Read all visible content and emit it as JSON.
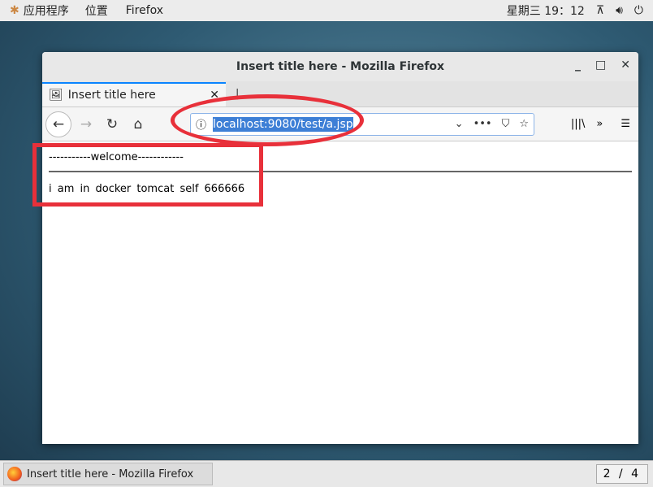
{
  "topbar": {
    "apps": "应用程序",
    "places": "位置",
    "app": "Firefox",
    "clock": "星期三 19：12"
  },
  "window": {
    "title": "Insert title here - Mozilla Firefox"
  },
  "tab": {
    "title": "Insert title here"
  },
  "urlbar": {
    "url": "localhost:9080/test/a.jsp"
  },
  "page": {
    "welcome": "-----------welcome------------",
    "message": "i am in docker tomcat self 666666"
  },
  "taskbar": {
    "task": "Insert title here - Mozilla Firefox",
    "workspace": "2 / 4"
  },
  "annotations": {
    "color": "#e8303a"
  }
}
